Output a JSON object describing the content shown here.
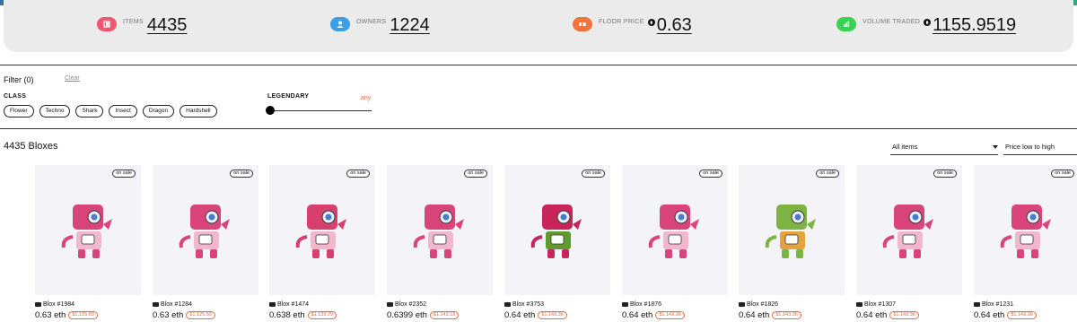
{
  "stats": [
    {
      "key": "items",
      "label": "ITEMS",
      "value": "4435",
      "color": "#f0566d",
      "icon": "cube-icon"
    },
    {
      "key": "owners",
      "label": "OWNERS",
      "value": "1224",
      "color": "#3b9ee6",
      "icon": "user-icon"
    },
    {
      "key": "floor",
      "label": "FLOOR PRICE",
      "value": "0.63",
      "color": "#f0743b",
      "icon": "ticket-icon"
    },
    {
      "key": "volume",
      "label": "VOLUME TRADED",
      "value": "1155.9519",
      "color": "#3bd04f",
      "icon": "bar-chart-icon"
    }
  ],
  "filter": {
    "title": "Filter (0)",
    "clear": "Clear",
    "class_heading": "CLASS",
    "classes": [
      "Flower",
      "Techno",
      "Shark",
      "Insect",
      "Dragon",
      "Hardshell"
    ],
    "legendary_heading": "LEGENDARY",
    "legendary_value": "any"
  },
  "listing": {
    "count_title": "4435 Bloxes",
    "filter_select": "All items",
    "sort_select": "Price low to high"
  },
  "cards": [
    {
      "name": "Blox #1984",
      "price": "0.63 eth",
      "usd": "$1,125.50",
      "badge": "on sale",
      "body": "#d9457a",
      "accent": "#f2b7ca"
    },
    {
      "name": "Blox #1284",
      "price": "0.63 eth",
      "usd": "$1,125.50",
      "badge": "on sale",
      "body": "#d9457a",
      "accent": "#f2b7ca"
    },
    {
      "name": "Blox #1474",
      "price": "0.638 eth",
      "usd": "$1,139.79",
      "badge": "on sale",
      "body": "#d63f6e",
      "accent": "#f2b7ca"
    },
    {
      "name": "Blox #2352",
      "price": "0.6399 eth",
      "usd": "$1,143.18",
      "badge": "on sale",
      "body": "#d9457a",
      "accent": "#f2b7ca"
    },
    {
      "name": "Blox #3753",
      "price": "0.64 eth",
      "usd": "$1,143.36",
      "badge": "on sale",
      "body": "#c7245a",
      "accent": "#5f9b2e"
    },
    {
      "name": "Blox #1876",
      "price": "0.64 eth",
      "usd": "$1,143.36",
      "badge": "on sale",
      "body": "#d9457a",
      "accent": "#f2b7ca"
    },
    {
      "name": "Blox #1826",
      "price": "0.64 eth",
      "usd": "$1,143.36",
      "badge": "on sale",
      "body": "#7cb342",
      "accent": "#e6a23c"
    },
    {
      "name": "Blox #1307",
      "price": "0.64 eth",
      "usd": "$1,143.36",
      "badge": "on sale",
      "body": "#d9457a",
      "accent": "#f2b7ca"
    },
    {
      "name": "Blox #1231",
      "price": "0.64 eth",
      "usd": "$1,143.36",
      "badge": "on sale",
      "body": "#d9457a",
      "accent": "#f2b7ca"
    }
  ]
}
